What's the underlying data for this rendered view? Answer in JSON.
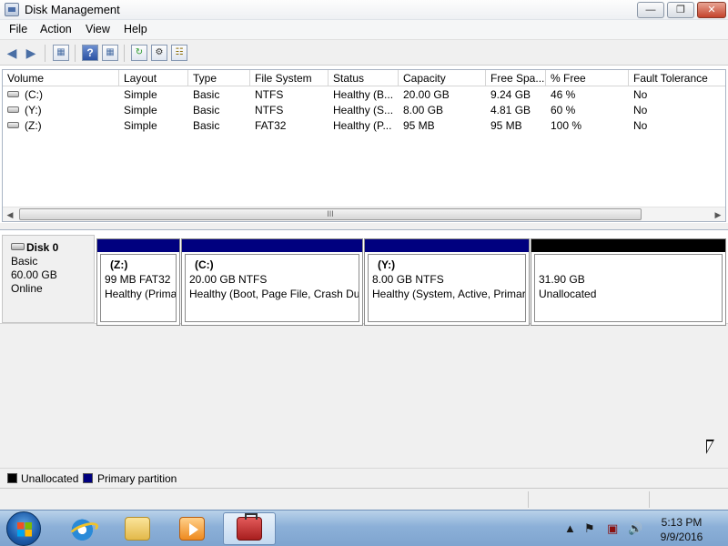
{
  "window": {
    "title": "Disk Management",
    "app_icon": "disk-management-icon"
  },
  "menu": [
    "File",
    "Action",
    "View",
    "Help"
  ],
  "toolbar": {
    "icons": [
      "back-arrow-icon",
      "forward-arrow-icon",
      "console-tree-icon",
      "help-icon",
      "properties-icon",
      "refresh-icon",
      "rescan-icon",
      "settings-icon"
    ]
  },
  "volume_list": {
    "columns": [
      "Volume",
      "Layout",
      "Type",
      "File System",
      "Status",
      "Capacity",
      "Free Spa...",
      "% Free",
      "Fault Tolerance"
    ],
    "rows": [
      [
        "(C:)",
        "Simple",
        "Basic",
        "NTFS",
        "Healthy (B...",
        "20.00 GB",
        "9.24 GB",
        "46 %",
        "No"
      ],
      [
        "(Y:)",
        "Simple",
        "Basic",
        "NTFS",
        "Healthy (S...",
        "8.00 GB",
        "4.81 GB",
        "60 %",
        "No"
      ],
      [
        "(Z:)",
        "Simple",
        "Basic",
        "FAT32",
        "Healthy (P...",
        "95 MB",
        "95 MB",
        "100 %",
        "No"
      ]
    ],
    "scroll_thumb_grip": "III"
  },
  "disk": {
    "name": "Disk 0",
    "type": "Basic",
    "size": "60.00 GB",
    "state": "Online",
    "partitions": [
      {
        "label": "(Z:)",
        "size": "99 MB FAT32",
        "status": "Healthy (Prima",
        "kind": "primary"
      },
      {
        "label": "(C:)",
        "size": "20.00 GB NTFS",
        "status": "Healthy (Boot, Page File, Crash Dur",
        "kind": "primary"
      },
      {
        "label": "(Y:)",
        "size": "8.00 GB NTFS",
        "status": "Healthy (System, Active, Primar",
        "kind": "primary"
      },
      {
        "label": "",
        "size": "31.90 GB",
        "status": "Unallocated",
        "kind": "unallocated"
      }
    ]
  },
  "legend": [
    {
      "label": "Unallocated",
      "color": "#000000"
    },
    {
      "label": "Primary partition",
      "color": "#00007f"
    }
  ],
  "taskbar": {
    "apps": [
      "internet-explorer-icon",
      "windows-explorer-icon",
      "media-player-icon",
      "computer-management-icon"
    ],
    "tray": [
      "show-hidden-icons-icon",
      "action-center-flag-icon",
      "network-icon",
      "volume-icon"
    ],
    "time": "5:13 PM",
    "date": "9/9/2016"
  },
  "colors": {
    "primary": "#00007f",
    "unallocated": "#000000",
    "window_bg": "#f0f0f0"
  }
}
